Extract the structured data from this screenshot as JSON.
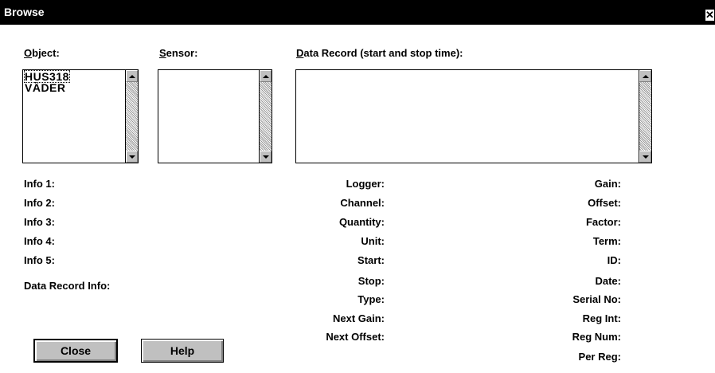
{
  "window": {
    "title": "Browse",
    "close_glyph": "✕"
  },
  "labels": {
    "object": "Object:",
    "object_accel": "O",
    "object_rest": "bject:",
    "sensor_accel": "S",
    "sensor_rest": "ensor:",
    "record_accel": "D",
    "record_rest": "ata Record (start and stop time):"
  },
  "object_list": [
    "HUS318",
    "VÄDER"
  ],
  "sensor_list": [],
  "record_list": [],
  "info_labels": [
    "Info 1:",
    "Info 2:",
    "Info 3:",
    "Info 4:",
    "Info 5:"
  ],
  "data_record_info": "Data Record Info:",
  "mid_labels": [
    "Logger:",
    "Channel:",
    "Quantity:",
    "Unit:",
    "Start:",
    "Stop:",
    "Type:",
    "Next Gain:",
    "Next Offset:"
  ],
  "right_labels": [
    "Gain:",
    "Offset:",
    "Factor:",
    "Term:",
    "ID:",
    "Date:",
    "Serial No:",
    "Reg Int:",
    "Reg Num:",
    "Per Reg:"
  ],
  "buttons": {
    "close": "Close",
    "help": "Help"
  },
  "icons": {
    "scroll_up": "up-arrow-icon",
    "scroll_down": "down-arrow-icon",
    "window_close": "close-icon"
  }
}
